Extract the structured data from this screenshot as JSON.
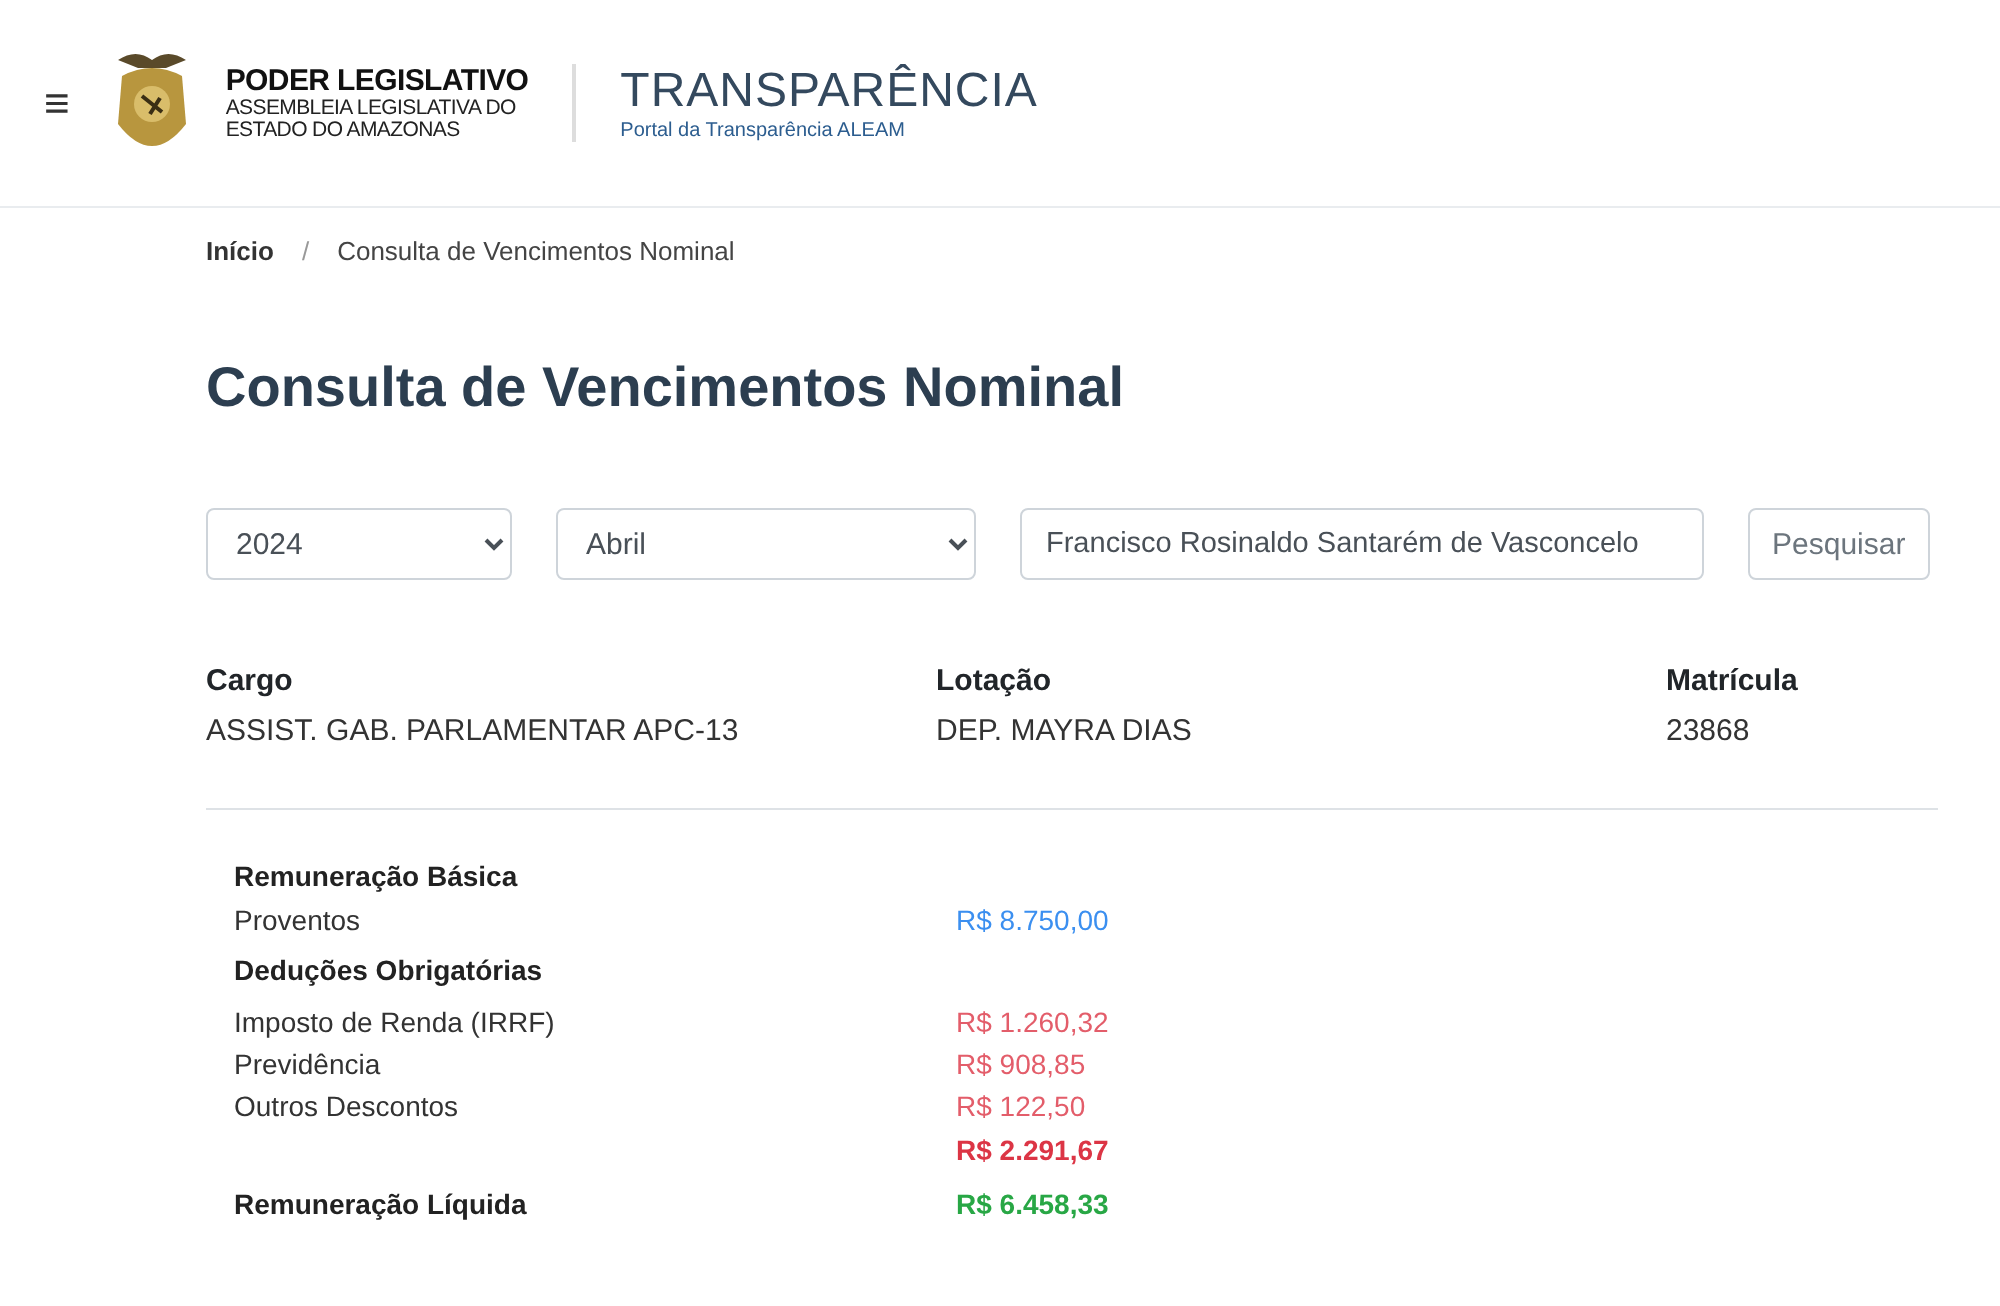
{
  "header": {
    "menu_icon": "≡",
    "org_title": "PODER LEGISLATIVO",
    "org_subtitle": [
      "ASSEMBLEIA LEGISLATIVA DO",
      "ESTADO DO AMAZONAS"
    ],
    "portal_title": "TRANSPARÊNCIA",
    "portal_subtitle": "Portal da Transparência ALEAM"
  },
  "breadcrumb": [
    {
      "label": "Início",
      "current": false
    },
    {
      "label": "Consulta de Vencimentos Nominal",
      "current": true
    }
  ],
  "breadcrumb_separator": "/",
  "page_title": "Consulta de Vencimentos Nominal",
  "filters": {
    "year": "2024",
    "month": "Abril",
    "name": "Francisco Rosinaldo Santarém de Vasconcelo",
    "search_button": "Pesquisar"
  },
  "info": [
    {
      "label": "Cargo",
      "value": "ASSIST. GAB. PARLAMENTAR APC-13"
    },
    {
      "label": "Lotação",
      "value": "DEP. MAYRA DIAS"
    },
    {
      "label": "Matrícula",
      "value": "23868"
    }
  ],
  "breakdown": [
    {
      "kind": "heading",
      "label": "Remuneração Básica"
    },
    {
      "kind": "item",
      "label": "Proventos",
      "value": "R$ 8.750,00",
      "color": "#3b8ff0"
    },
    {
      "kind": "heading",
      "label": "Deduções Obrigatórias"
    },
    {
      "kind": "item",
      "label": "Imposto de Renda (IRRF)",
      "value": "R$ 1.260,32",
      "color": "#e35d6a"
    },
    {
      "kind": "item",
      "label": "Previdência",
      "value": "R$ 908,85",
      "color": "#e35d6a"
    },
    {
      "kind": "item",
      "label": "Outros Descontos",
      "value": "R$ 122,50",
      "color": "#e35d6a"
    },
    {
      "kind": "total",
      "value": "R$ 2.291,67",
      "color": "#dc3545"
    },
    {
      "kind": "heading",
      "label": "Remuneração Líquida",
      "value": "R$ 6.458,33",
      "color": "#28a745"
    }
  ]
}
